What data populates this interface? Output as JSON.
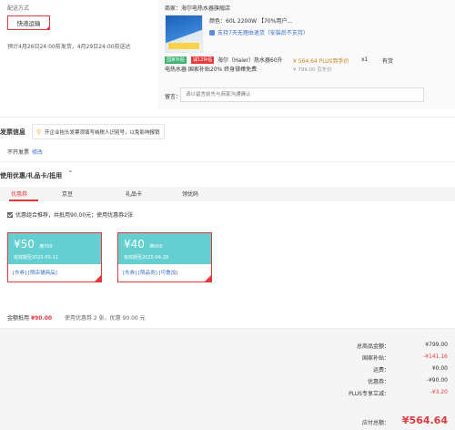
{
  "delivery": {
    "label": "配送方式",
    "shipping_button": "快递运输",
    "eta": "预计4月26日24:00前发货，4月29日24:00前送达"
  },
  "product": {
    "shop": "商家：海尔电热水器旗舰店",
    "spec": "颜色：60L 2200W 【70%用户...",
    "return_policy": "支持7天无理由退货（安装后不支持）",
    "badge_subsidy": "国家补贴",
    "badge_discount": "减12补贴",
    "title": "海尔（Haier）热水器60升电热水器 国家补贴20% 终身镁棒免费",
    "price_plus": "¥ 564.64 PLUS到手价",
    "price_original": "¥ 799.00 京东价",
    "quantity": "x1",
    "stock": "有货",
    "remark_label": "留言：",
    "remark_placeholder": "请以留言前先与商家沟通确认"
  },
  "invoice": {
    "title": "发票信息",
    "tip": "开企业抬头发票须填写纳税人识别号，以免影响报销",
    "status": "不开发票",
    "modify": "修改"
  },
  "coupons": {
    "title": "使用优惠/礼品卡/抵用",
    "tabs": [
      "优惠券",
      "京豆",
      "礼品卡",
      "领优码"
    ],
    "combo_text": "优惠组合推荐，共抵用90.00元；使用优惠券2张",
    "items": [
      {
        "amount": "¥50",
        "condition": "满700",
        "validity": "有效期至2025-05-11",
        "tags": "[东券] [限店铺商品]"
      },
      {
        "amount": "¥40",
        "condition": "满500",
        "validity": "有效期至2025-04-28",
        "tags": "[东券] [限品类] [可叠加]"
      }
    ],
    "summary_label": "金额抵用",
    "summary_amount": "¥90.00",
    "summary_note": "使用优惠券 2 张，优惠 90.00 元"
  },
  "totals": {
    "rows": [
      {
        "label": "总商品金额：",
        "value": "¥799.00",
        "color": "#333333"
      },
      {
        "label": "国家补贴：",
        "value": "-¥141.16",
        "color": "#e4393c"
      },
      {
        "label": "运费：",
        "value": "¥0.00",
        "color": "#333333"
      },
      {
        "label": "优惠券：",
        "value": "-¥90.00",
        "color": "#333333"
      },
      {
        "label": "PLUS专享立减：",
        "value": "-¥3.20",
        "color": "#e4393c"
      }
    ],
    "pay_label": "应付总额：",
    "pay_value": "¥564.64"
  }
}
